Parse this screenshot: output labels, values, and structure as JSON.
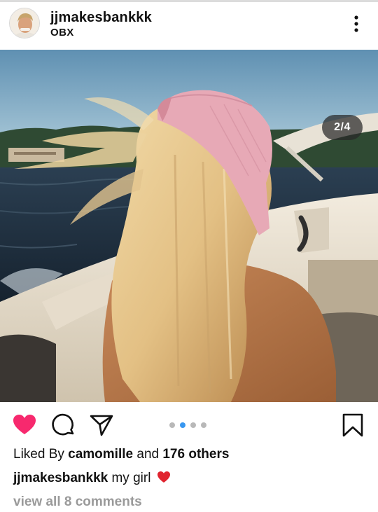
{
  "post": {
    "username": "jjmakesbankkk",
    "location": "OBX",
    "image_counter": "2/4",
    "carousel": {
      "total": 4,
      "active": 2
    },
    "liked": true,
    "likes": {
      "prefix": "Liked By",
      "liker": "camomille",
      "conjunction": "and",
      "others": "176 others"
    },
    "caption": {
      "username": "jjmakesbankkk",
      "text": "my girl"
    },
    "view_comments": "view all 8 comments"
  },
  "colors": {
    "like_active": "#f7296e",
    "carousel_active": "#3897f0",
    "carousel_inactive": "#b8b8b8",
    "muted_text": "#9a9a9a"
  },
  "icons": [
    "more-options-icon",
    "heart-icon",
    "comment-icon",
    "share-icon",
    "bookmark-icon",
    "red-heart-emoji"
  ]
}
